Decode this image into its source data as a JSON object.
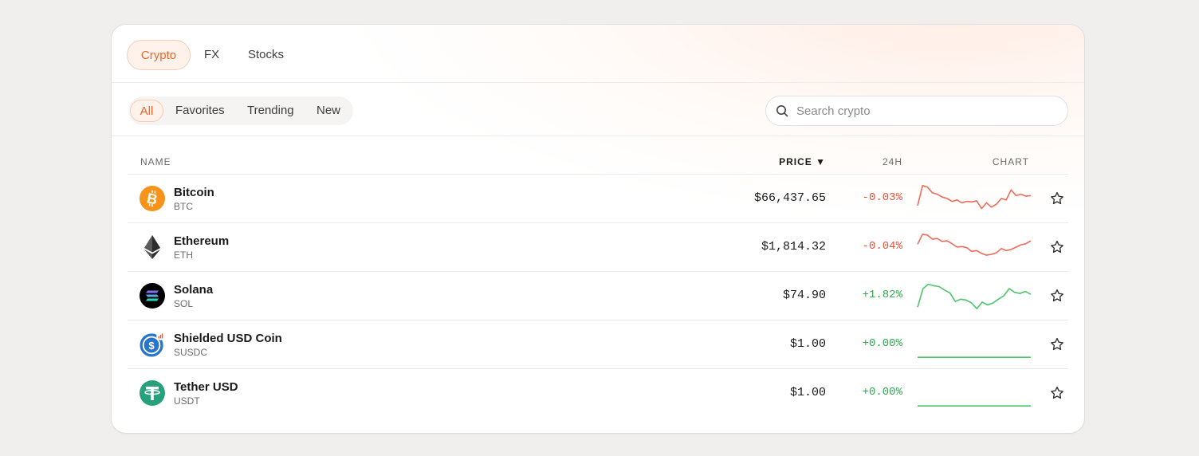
{
  "top_tabs": [
    {
      "label": "Crypto",
      "active": true
    },
    {
      "label": "FX",
      "active": false
    },
    {
      "label": "Stocks",
      "active": false
    }
  ],
  "filters": [
    {
      "label": "All",
      "active": true
    },
    {
      "label": "Favorites",
      "active": false
    },
    {
      "label": "Trending",
      "active": false
    },
    {
      "label": "New",
      "active": false
    }
  ],
  "search": {
    "placeholder": "Search crypto",
    "icon": "search-icon"
  },
  "table": {
    "headers": {
      "name": "NAME",
      "price": "PRICE ▼",
      "change": "24H",
      "chart": "CHART"
    },
    "rows": [
      {
        "name": "Bitcoin",
        "symbol": "BTC",
        "price": "$66,437.65",
        "change": "-0.03%",
        "trend": "down",
        "icon": "bitcoin-icon",
        "color": "#f7931a",
        "spark": [
          0.25,
          0.95,
          0.9,
          0.7,
          0.65,
          0.55,
          0.5,
          0.4,
          0.45,
          0.35,
          0.4,
          0.38,
          0.42,
          0.15,
          0.35,
          0.2,
          0.3,
          0.5,
          0.45,
          0.8,
          0.6,
          0.65,
          0.58,
          0.6
        ]
      },
      {
        "name": "Ethereum",
        "symbol": "ETH",
        "price": "$1,814.32",
        "change": "-0.04%",
        "trend": "down",
        "icon": "ethereum-icon",
        "color": "#3c3c3d",
        "spark": [
          0.6,
          0.95,
          0.92,
          0.78,
          0.8,
          0.7,
          0.72,
          0.62,
          0.5,
          0.52,
          0.48,
          0.35,
          0.38,
          0.28,
          0.22,
          0.25,
          0.3,
          0.45,
          0.38,
          0.42,
          0.5,
          0.58,
          0.62,
          0.72
        ]
      },
      {
        "name": "Solana",
        "symbol": "SOL",
        "price": "$74.90",
        "change": "+1.82%",
        "trend": "up",
        "icon": "solana-icon",
        "color": "#000000",
        "spark": [
          0.1,
          0.75,
          0.9,
          0.85,
          0.82,
          0.7,
          0.6,
          0.3,
          0.38,
          0.35,
          0.25,
          0.05,
          0.28,
          0.18,
          0.25,
          0.38,
          0.5,
          0.75,
          0.62,
          0.58,
          0.65,
          0.55
        ]
      },
      {
        "name": "Shielded USD Coin",
        "symbol": "SUSDC",
        "price": "$1.00",
        "change": "+0.00%",
        "trend": "up",
        "icon": "shielded-usd-coin-icon",
        "color": "#2775ca",
        "spark": [
          0.05,
          0.05
        ]
      },
      {
        "name": "Tether USD",
        "symbol": "USDT",
        "price": "$1.00",
        "change": "+0.00%",
        "trend": "up",
        "icon": "tether-icon",
        "color": "#26a17b",
        "spark": [
          0.05,
          0.05
        ]
      }
    ]
  },
  "colors": {
    "accent": "#e9662c",
    "negative": "#e5533f",
    "positive": "#32a852",
    "spark_negative": "#ef6b57",
    "spark_positive": "#4cc46a"
  }
}
